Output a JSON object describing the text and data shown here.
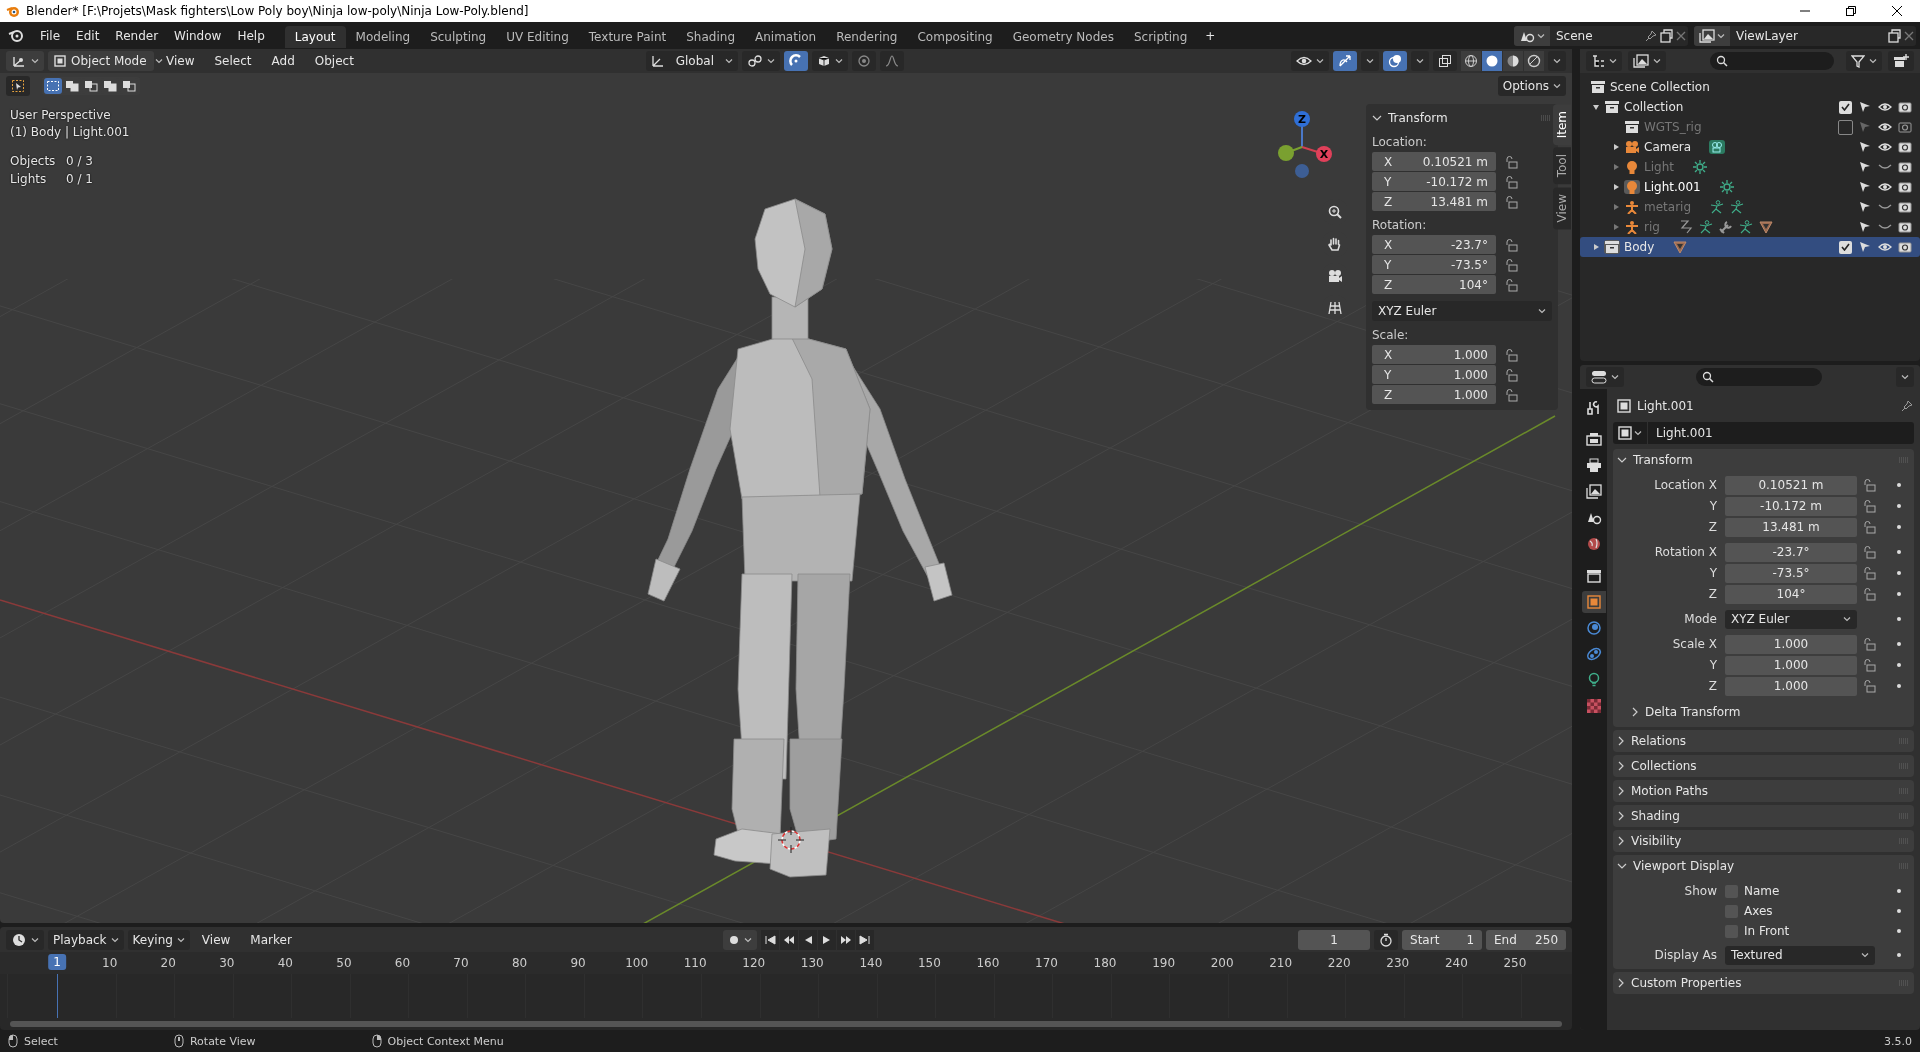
{
  "window": {
    "title": "Blender* [F:\\Projets\\Mask fighters\\Low Poly boy\\Ninja low-poly\\Ninja Low-Poly.blend]"
  },
  "menu": [
    "File",
    "Edit",
    "Render",
    "Window",
    "Help"
  ],
  "workspaces": [
    {
      "label": "Layout",
      "selected": true
    },
    {
      "label": "Modeling",
      "selected": false
    },
    {
      "label": "Sculpting",
      "selected": false
    },
    {
      "label": "UV Editing",
      "selected": false
    },
    {
      "label": "Texture Paint",
      "selected": false
    },
    {
      "label": "Shading",
      "selected": false
    },
    {
      "label": "Animation",
      "selected": false
    },
    {
      "label": "Rendering",
      "selected": false
    },
    {
      "label": "Compositing",
      "selected": false
    },
    {
      "label": "Geometry Nodes",
      "selected": false
    },
    {
      "label": "Scripting",
      "selected": false
    }
  ],
  "add_workspace": "+",
  "scene": "Scene",
  "view_layer": "ViewLayer",
  "viewport": {
    "mode": "Object Mode",
    "menu": [
      "View",
      "Select",
      "Add",
      "Object"
    ],
    "orientation": "Global",
    "options": "Options",
    "shading_modes": [
      {
        "kind": "wireframe",
        "selected": false
      },
      {
        "kind": "solid",
        "selected": true
      },
      {
        "kind": "material",
        "selected": false
      },
      {
        "kind": "rendered",
        "selected": false
      }
    ],
    "perspective": "User Perspective",
    "context": "(1) Body | Light.001",
    "stats": [
      {
        "label": "Objects",
        "value": "0 / 3"
      },
      {
        "label": "Lights",
        "value": "0 / 1"
      }
    ],
    "gizmo": {
      "z": "Z",
      "x": "X"
    }
  },
  "sidebar": {
    "tabs": [
      {
        "label": "Item",
        "selected": true
      },
      {
        "label": "Tool",
        "selected": false
      },
      {
        "label": "View",
        "selected": false
      }
    ],
    "title": "Transform",
    "location": {
      "label": "Location:",
      "fields": [
        {
          "axis": "X",
          "value": "0.10521 m"
        },
        {
          "axis": "Y",
          "value": "-10.172 m"
        },
        {
          "axis": "Z",
          "value": "13.481 m"
        }
      ]
    },
    "rotation": {
      "label": "Rotation:",
      "fields": [
        {
          "axis": "X",
          "value": "-23.7°"
        },
        {
          "axis": "Y",
          "value": "-73.5°"
        },
        {
          "axis": "Z",
          "value": "104°"
        }
      ]
    },
    "rotation_mode": "XYZ Euler",
    "scale": {
      "label": "Scale:",
      "fields": [
        {
          "axis": "X",
          "value": "1.000"
        },
        {
          "axis": "Y",
          "value": "1.000"
        },
        {
          "axis": "Z",
          "value": "1.000"
        }
      ]
    }
  },
  "outliner": {
    "root": "Scene Collection",
    "items": [
      {
        "label": "Collection",
        "kind": "collection",
        "expanded": true,
        "checked": true,
        "visible": true,
        "selected": false,
        "active": false,
        "children": [
          {
            "label": "WGTS_rig",
            "kind": "collection",
            "checked": false,
            "visible": true,
            "selected": false,
            "active": false
          },
          {
            "label": "Camera",
            "kind": "camera",
            "expanded": false,
            "visible": true,
            "selected": false,
            "active": false,
            "data_icons": [
              {
                "kind": "camera"
              }
            ]
          },
          {
            "label": "Light",
            "kind": "light",
            "expanded": false,
            "visible": false,
            "selected": false,
            "active": false,
            "data_icons": [
              {
                "kind": "light"
              }
            ]
          },
          {
            "label": "Light.001",
            "kind": "light",
            "expanded": false,
            "visible": true,
            "selected": false,
            "active": true,
            "data_icons": [
              {
                "kind": "light"
              }
            ]
          },
          {
            "label": "metarig",
            "kind": "armature",
            "expanded": false,
            "visible": false,
            "selected": false,
            "active": false,
            "data_icons": [
              {
                "kind": "armature"
              },
              {
                "kind": "armature"
              }
            ]
          },
          {
            "label": "rig",
            "kind": "armature",
            "expanded": false,
            "visible": false,
            "selected": false,
            "active": false,
            "data_icons": [
              {
                "kind": "curve"
              },
              {
                "kind": "armature"
              },
              {
                "kind": "bone"
              },
              {
                "kind": "armature"
              },
              {
                "kind": "mesh"
              }
            ]
          }
        ]
      },
      {
        "label": "Body",
        "kind": "collection",
        "expanded": false,
        "checked": true,
        "visible": true,
        "selected": true,
        "active": true,
        "data_icons": [
          {
            "kind": "mesh"
          }
        ]
      }
    ]
  },
  "properties": {
    "tabs": [
      {
        "kind": "tool",
        "selected": false
      },
      {
        "kind": "render",
        "selected": false
      },
      {
        "kind": "output",
        "selected": false
      },
      {
        "kind": "view_layer",
        "selected": false
      },
      {
        "kind": "scene",
        "selected": false
      },
      {
        "kind": "world",
        "selected": false
      },
      {
        "kind": "collection",
        "selected": false
      },
      {
        "kind": "object",
        "selected": true
      },
      {
        "kind": "physics",
        "selected": false
      },
      {
        "kind": "constraints",
        "selected": false
      },
      {
        "kind": "data",
        "selected": false
      },
      {
        "kind": "texture",
        "selected": false
      }
    ],
    "object_name": "Light.001",
    "datablock": "Light.001",
    "transform": {
      "title": "Transform",
      "groups": [
        {
          "rows": [
            {
              "label": "Location X",
              "value": "0.10521 m",
              "kind": "number"
            },
            {
              "label": "Y",
              "value": "-10.172 m",
              "kind": "number"
            },
            {
              "label": "Z",
              "value": "13.481 m",
              "kind": "number"
            }
          ]
        },
        {
          "rows": [
            {
              "label": "Rotation X",
              "value": "-23.7°",
              "kind": "number"
            },
            {
              "label": "Y",
              "value": "-73.5°",
              "kind": "number"
            },
            {
              "label": "Z",
              "value": "104°",
              "kind": "number"
            }
          ]
        },
        {
          "rows": [
            {
              "label": "Mode",
              "value": "XYZ Euler",
              "kind": "dropdown"
            }
          ]
        },
        {
          "rows": [
            {
              "label": "Scale X",
              "value": "1.000",
              "kind": "number"
            },
            {
              "label": "Y",
              "value": "1.000",
              "kind": "number"
            },
            {
              "label": "Z",
              "value": "1.000",
              "kind": "number"
            }
          ]
        }
      ],
      "subpanel": {
        "title": "Delta Transform",
        "expanded": false
      }
    },
    "panels": [
      {
        "title": "Relations",
        "expanded": false
      },
      {
        "title": "Collections",
        "expanded": false
      },
      {
        "title": "Motion Paths",
        "expanded": false
      },
      {
        "title": "Shading",
        "expanded": false
      },
      {
        "title": "Visibility",
        "expanded": false
      },
      {
        "title": "Viewport Display",
        "expanded": true,
        "show": {
          "label": "Show",
          "options": [
            {
              "label": "Name",
              "checked": false
            },
            {
              "label": "Axes",
              "checked": false
            },
            {
              "label": "In Front",
              "checked": false
            }
          ]
        },
        "display_as": {
          "label": "Display As",
          "value": "Textured"
        }
      },
      {
        "title": "Custom Properties",
        "expanded": false
      }
    ]
  },
  "timeline": {
    "menu": [
      "Playback",
      "Keying",
      "View",
      "Marker"
    ],
    "current_frame": "1",
    "start": {
      "label": "Start",
      "value": "1"
    },
    "end": {
      "label": "End",
      "value": "250"
    },
    "playhead": "1",
    "ticks": [
      "10",
      "20",
      "30",
      "40",
      "50",
      "60",
      "70",
      "80",
      "90",
      "100",
      "110",
      "120",
      "130",
      "140",
      "150",
      "160",
      "170",
      "180",
      "190",
      "200",
      "210",
      "220",
      "230",
      "240",
      "250"
    ]
  },
  "status_bar": {
    "hints": [
      {
        "kind": "left",
        "label": "Select"
      },
      {
        "kind": "middle",
        "label": "Rotate View"
      },
      {
        "kind": "right",
        "label": "Object Context Menu"
      }
    ],
    "version": "3.5.0"
  }
}
